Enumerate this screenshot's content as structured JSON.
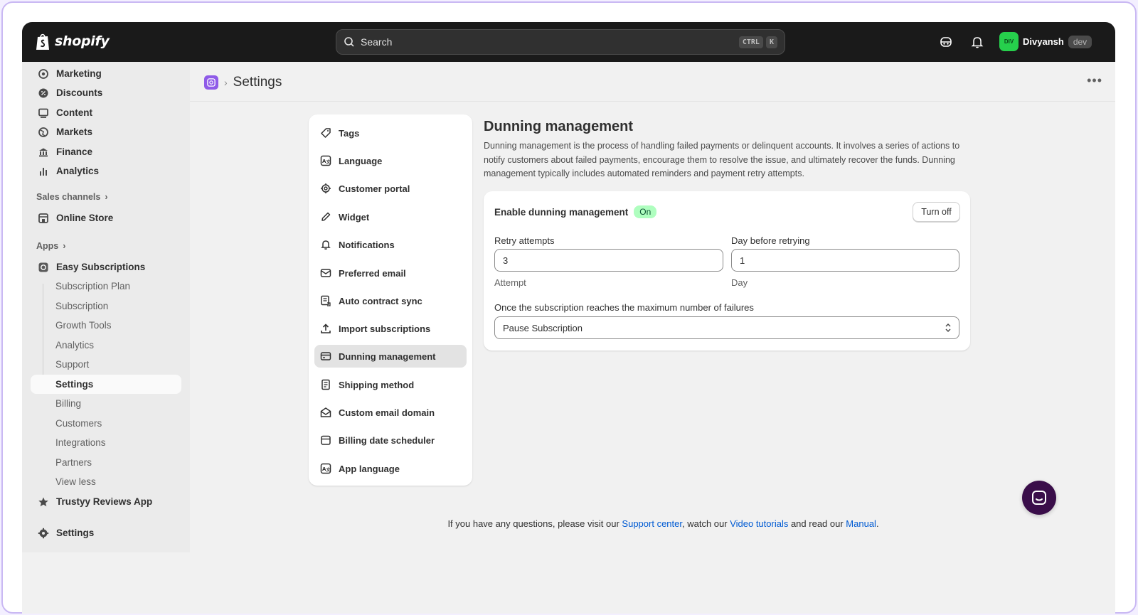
{
  "topbar": {
    "logo_text": "shopify",
    "search_placeholder": "Search",
    "shortcut_ctrl": "CTRL",
    "shortcut_k": "K",
    "user_initials": "DIV",
    "user_name": "Divyansh",
    "user_badge": "dev"
  },
  "sidebar": {
    "items": [
      {
        "label": "Marketing",
        "icon": "target-icon"
      },
      {
        "label": "Discounts",
        "icon": "discount-icon"
      },
      {
        "label": "Content",
        "icon": "content-icon"
      },
      {
        "label": "Markets",
        "icon": "globe-icon"
      },
      {
        "label": "Finance",
        "icon": "bank-icon"
      },
      {
        "label": "Analytics",
        "icon": "bar-chart-icon"
      }
    ],
    "sales_channels_label": "Sales channels",
    "online_store_label": "Online Store",
    "apps_label": "Apps",
    "app_name": "Easy Subscriptions",
    "app_subitems": [
      "Subscription Plan",
      "Subscription",
      "Growth Tools",
      "Analytics",
      "Support",
      "Settings",
      "Billing",
      "Customers",
      "Integrations",
      "Partners",
      "View less"
    ],
    "active_subitem": "Settings",
    "other_app": "Trustyy Reviews App",
    "settings_label": "Settings"
  },
  "page": {
    "title": "Settings",
    "more_label": "•••"
  },
  "settings_menu": [
    {
      "label": "Tags",
      "icon": "tag-icon"
    },
    {
      "label": "Language",
      "icon": "translate-icon"
    },
    {
      "label": "Customer portal",
      "icon": "gear-icon"
    },
    {
      "label": "Widget",
      "icon": "pencil-icon"
    },
    {
      "label": "Notifications",
      "icon": "bell-icon"
    },
    {
      "label": "Preferred email",
      "icon": "email-icon"
    },
    {
      "label": "Auto contract sync",
      "icon": "contract-icon"
    },
    {
      "label": "Import subscriptions",
      "icon": "upload-icon"
    },
    {
      "label": "Dunning management",
      "icon": "credit-card-icon"
    },
    {
      "label": "Shipping method",
      "icon": "receipt-icon"
    },
    {
      "label": "Custom email domain",
      "icon": "open-email-icon"
    },
    {
      "label": "Billing date scheduler",
      "icon": "calendar-icon"
    },
    {
      "label": "App language",
      "icon": "translate-icon"
    }
  ],
  "active_menu": "Dunning management",
  "dunning": {
    "title": "Dunning management",
    "description": "Dunning management is the process of handling failed payments or delinquent accounts. It involves a series of actions to notify customers about failed payments, encourage them to resolve the issue, and ultimately recover the funds. Dunning management typically includes automated reminders and payment retry attempts.",
    "enable_label": "Enable dunning management",
    "status_badge": "On",
    "toggle_button": "Turn off",
    "retry_label": "Retry attempts",
    "retry_value": "3",
    "retry_help": "Attempt",
    "day_label": "Day before retrying",
    "day_value": "1",
    "day_help": "Day",
    "max_fail_label": "Once the subscription reaches the maximum number of failures",
    "max_fail_value": "Pause Subscription"
  },
  "footer": {
    "text_1": "If you have any questions, please visit our ",
    "link_1": "Support center",
    "text_2": ", watch our ",
    "link_2": "Video tutorials",
    "text_3": " and read our ",
    "link_3": "Manual",
    "text_4": "."
  },
  "colors": {
    "topbar": "#1a1a1a",
    "accent_app": "#8f5be8",
    "on_badge": "#affebf",
    "link": "#005bd3",
    "chat": "#3a0e4a"
  }
}
